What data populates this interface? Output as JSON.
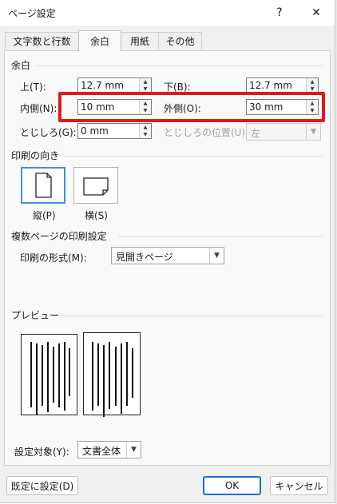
{
  "window": {
    "title": "ページ設定",
    "help": "?",
    "close": "✕"
  },
  "tabs": [
    "文字数と行数",
    "余白",
    "用紙",
    "その他"
  ],
  "margins": {
    "section": "余白",
    "top_label": "上(T):",
    "top_value": "12.7 mm",
    "bottom_label": "下(B):",
    "bottom_value": "12.7 mm",
    "inside_label": "内側(N):",
    "inside_value": "10 mm",
    "outside_label": "外側(O):",
    "outside_value": "30 mm",
    "gutter_label": "とじしろ(G):",
    "gutter_value": "0 mm",
    "gutter_pos_label": "とじしろの位置(U):",
    "gutter_pos_value": "左"
  },
  "orientation": {
    "section": "印刷の向き",
    "portrait": "縦(P)",
    "landscape": "横(S)",
    "selected": "portrait"
  },
  "pages": {
    "section": "複数ページの印刷設定",
    "format_label": "印刷の形式(M):",
    "format_value": "見開きページ"
  },
  "preview": {
    "section": "プレビュー"
  },
  "apply": {
    "label": "設定対象(Y):",
    "value": "文書全体"
  },
  "buttons": {
    "default": "既定に設定(D)",
    "ok": "OK",
    "cancel": "キャンセル"
  }
}
